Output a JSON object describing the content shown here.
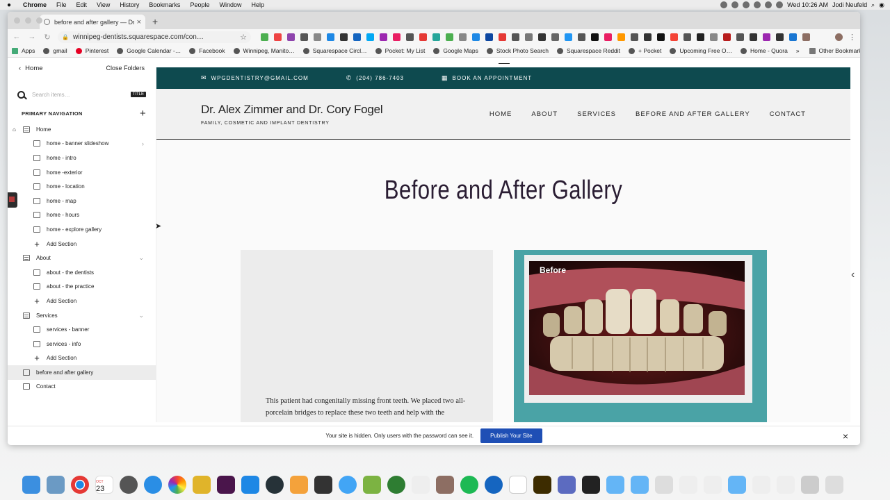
{
  "menubar": {
    "app": "Chrome",
    "items": [
      "File",
      "Edit",
      "View",
      "History",
      "Bookmarks",
      "People",
      "Window",
      "Help"
    ],
    "clock": "Wed 10:26 AM",
    "user": "Jodi Neufeld"
  },
  "browser": {
    "tab_title": "before and after gallery — Dr…",
    "url": "winnipeg-dentists.squarespace.com/con…",
    "bookmarks": [
      "Apps",
      "gmail",
      "Pinterest",
      "Google Calendar -…",
      "Facebook",
      "Winnipeg, Manito…",
      "Squarespace Circl…",
      "Pocket: My List",
      "Google Maps",
      "Stock Photo Search",
      "Squarespace Reddit",
      "+ Pocket",
      "Upcoming Free O…",
      "Home - Quora"
    ],
    "more": "»",
    "other_bookmarks": "Other Bookmarks",
    "extension_colors": [
      "#4caf50",
      "#e44",
      "#8e44ad",
      "#555",
      "#888",
      "#1e88e5",
      "#333",
      "#1565c0",
      "#03a9f4",
      "#9c27b0",
      "#e91e63",
      "#555",
      "#e53935",
      "#26a69a",
      "#4caf50",
      "#888",
      "#1e88e5",
      "#0d47a1",
      "#e53935",
      "#555",
      "#777",
      "#333",
      "#666",
      "#2196f3",
      "#555",
      "#111",
      "#e91e63",
      "#ff9800",
      "#555",
      "#333",
      "#111",
      "#f44336",
      "#555",
      "#222",
      "#888",
      "#b71c1c",
      "#555",
      "#333",
      "#9c27b0",
      "#333",
      "#1976d2",
      "#8d6e63"
    ]
  },
  "sidebar": {
    "back_label": "Home",
    "close_folders": "Close Folders",
    "search_placeholder": "Search items…",
    "title_badge": "TITLE",
    "section_title": "PRIMARY NAVIGATION",
    "items": [
      {
        "label": "Home",
        "level": 1,
        "type": "folder",
        "home": true
      },
      {
        "label": "home - banner slideshow",
        "level": 2,
        "type": "gallery",
        "chevron": "›"
      },
      {
        "label": "home - intro",
        "level": 2,
        "type": "page"
      },
      {
        "label": "home -exterior",
        "level": 2,
        "type": "page"
      },
      {
        "label": "home - location",
        "level": 2,
        "type": "page"
      },
      {
        "label": "home - map",
        "level": 2,
        "type": "page"
      },
      {
        "label": "home - hours",
        "level": 2,
        "type": "page"
      },
      {
        "label": "home - explore gallery",
        "level": 2,
        "type": "page"
      },
      {
        "label": "Add Section",
        "level": 2,
        "type": "add"
      },
      {
        "label": "About",
        "level": 1,
        "type": "folder",
        "chevron": "⌄"
      },
      {
        "label": "about - the dentists",
        "level": 2,
        "type": "page"
      },
      {
        "label": "about - the practice",
        "level": 2,
        "type": "page"
      },
      {
        "label": "Add Section",
        "level": 2,
        "type": "add"
      },
      {
        "label": "Services",
        "level": 1,
        "type": "folder",
        "chevron": "⌄"
      },
      {
        "label": "services - banner",
        "level": 2,
        "type": "page"
      },
      {
        "label": "services - info",
        "level": 2,
        "type": "page"
      },
      {
        "label": "Add Section",
        "level": 2,
        "type": "add"
      },
      {
        "label": "before and after gallery",
        "level": 1,
        "type": "page",
        "selected": true
      },
      {
        "label": "Contact",
        "level": 1,
        "type": "page"
      }
    ]
  },
  "site": {
    "topbar": {
      "email": "WPGDENTISTRY@GMAIL.COM",
      "phone": "(204) 786-7403",
      "booking": "BOOK AN APPOINTMENT"
    },
    "brand_name": "Dr. Alex Zimmer and Dr. Cory Fogel",
    "brand_tagline": "FAMILY, COSMETIC AND IMPLANT DENTISTRY",
    "nav": [
      "HOME",
      "ABOUT",
      "SERVICES",
      "BEFORE AND AFTER GALLERY",
      "CONTACT"
    ],
    "page_title": "Before and After Gallery",
    "gallery": {
      "description": "This patient had congenitally missing front teeth. We placed two all-porcelain bridges to replace these two teeth and help with the",
      "photo_label": "Before"
    },
    "colors": {
      "topbar": "#0e4a4f",
      "card_accent": "#4aa3a6",
      "publish": "#1f4fb5"
    }
  },
  "footer": {
    "notice": "Your site is hidden. Only users with the password can see it.",
    "publish_label": "Publish Your Site",
    "close": "×"
  },
  "dock": {
    "calendar_month": "OCT",
    "calendar_day": "23"
  }
}
